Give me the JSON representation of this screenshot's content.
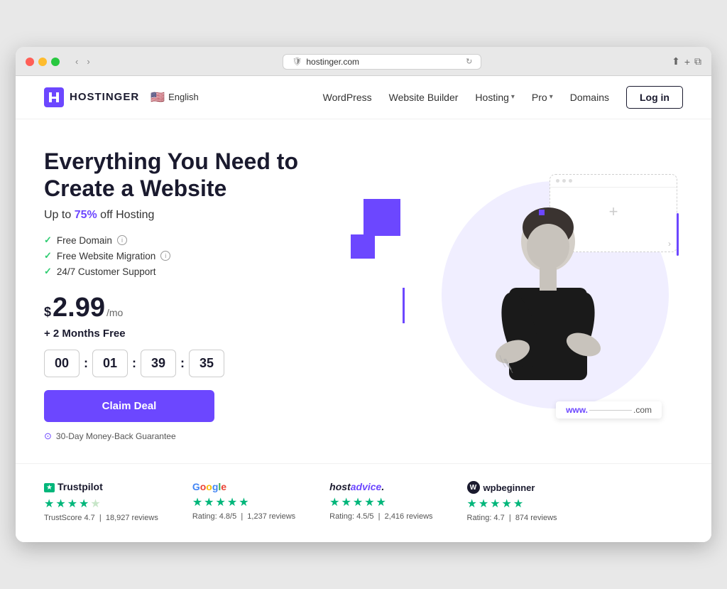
{
  "browser": {
    "url": "hostinger.com",
    "back_btn": "‹",
    "forward_btn": "›",
    "shield": "🛡"
  },
  "navbar": {
    "logo_text": "HOSTINGER",
    "lang": "English",
    "nav_items": [
      {
        "label": "WordPress",
        "has_dropdown": false
      },
      {
        "label": "Website Builder",
        "has_dropdown": false
      },
      {
        "label": "Hosting",
        "has_dropdown": true
      },
      {
        "label": "Pro",
        "has_dropdown": true
      },
      {
        "label": "Domains",
        "has_dropdown": false
      }
    ],
    "login_label": "Log in"
  },
  "hero": {
    "title": "Everything You Need to Create a Website",
    "subtitle_before": "Up to ",
    "subtitle_highlight": "75%",
    "subtitle_after": " off Hosting",
    "features": [
      {
        "text": "Free Domain",
        "has_info": true
      },
      {
        "text": "Free Website Migration",
        "has_info": true
      },
      {
        "text": "24/7 Customer Support",
        "has_info": false
      }
    ],
    "price_currency": "$",
    "price_amount": "2.99",
    "price_period": "/mo",
    "price_bonus": "+ 2 Months Free",
    "countdown": {
      "hours": "00",
      "minutes": "01",
      "seconds": "39",
      "frames": "35"
    },
    "cta_label": "Claim Deal",
    "money_back": "30-Day Money-Back Guarantee",
    "domain_www": "www.",
    "domain_com": ".com"
  },
  "reviews": [
    {
      "brand": "Trustpilot",
      "type": "trustpilot",
      "stars": 4.5,
      "score_label": "TrustScore 4.7",
      "reviews_count": "18,927 reviews"
    },
    {
      "brand": "Google",
      "type": "google",
      "stars": 5,
      "score_label": "Rating: 4.8/5",
      "reviews_count": "1,237 reviews"
    },
    {
      "brand": "hostadvice.",
      "type": "hostadvice",
      "stars": 5,
      "score_label": "Rating: 4.5/5",
      "reviews_count": "2,416 reviews"
    },
    {
      "brand": "wpbeginner",
      "type": "wpbeginner",
      "stars": 5,
      "score_label": "Rating: 4.7",
      "reviews_count": "874 reviews"
    }
  ]
}
